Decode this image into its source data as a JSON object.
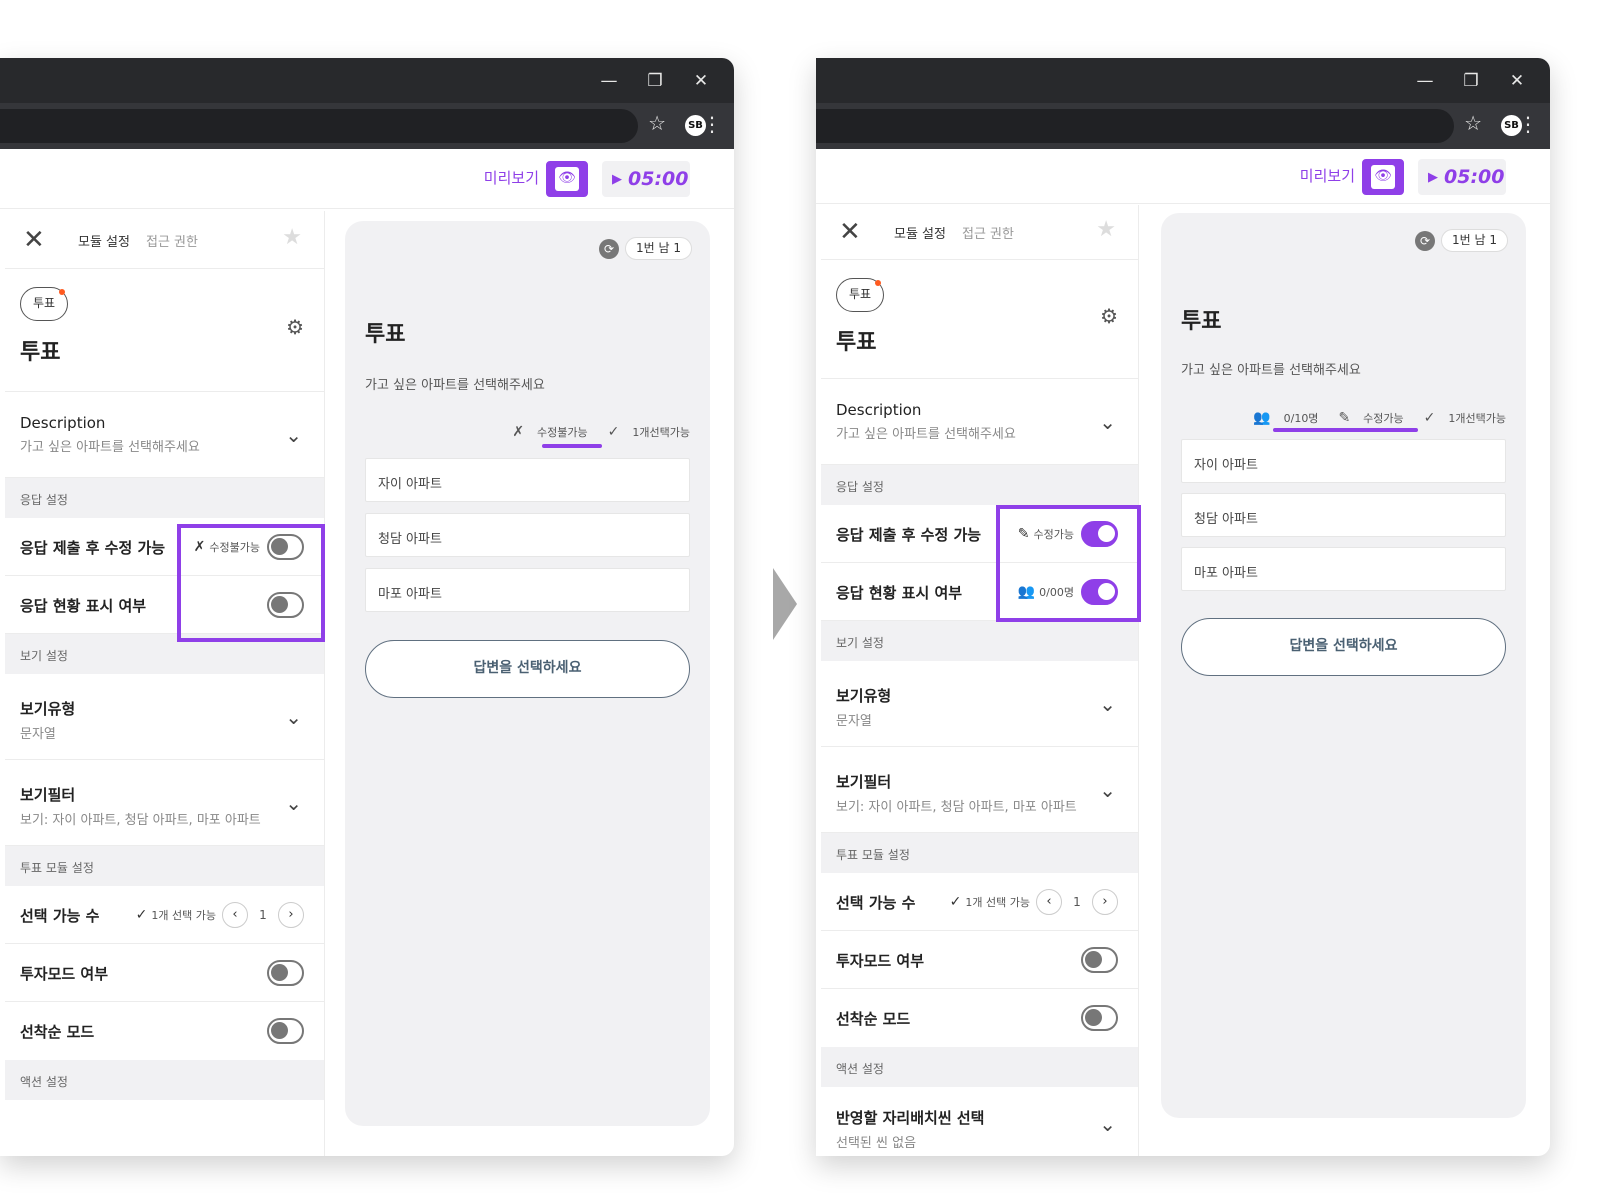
{
  "colors": {
    "accent": "#8f3fe8",
    "chrome": "#28292c",
    "panel_bg": "#f1f1f3",
    "notification_dot": "#ff5a1f"
  },
  "icons": {
    "minimize": "—",
    "restore": "❐",
    "close": "✕",
    "bookmark": "☆",
    "menu": "⋮",
    "eye": "👁",
    "play": "▶",
    "settings": "⚙",
    "chevron": "⌄",
    "prev": "‹",
    "next": "›",
    "check": "✓",
    "edit": "✎",
    "no_edit": "✗",
    "people": "👥",
    "sync": "⟳",
    "star": "★"
  },
  "common": {
    "profile": "SB",
    "preview_label": "미리보기",
    "timer": "05:00",
    "tab_module_settings": "모듈 설정",
    "tab_access": "접근 권한",
    "chip_label": "투표",
    "module_title": "투표",
    "description_label": "Description",
    "description_value": "가고 싶은 아파트를 선택해주세요",
    "section_response": "응답 설정",
    "edit_after_submit": "응답 제출 후 수정 가능",
    "show_status": "응답 현황 표시 여부",
    "section_view": "보기 설정",
    "view_type_label": "보기유형",
    "view_type_value": "문자열",
    "view_filter_label": "보기필터",
    "view_filter_value": "보기: 자이 아파트, 청담 아파트, 마포 아파트",
    "section_vote": "투표 모듈 설정",
    "selectable_count": "선택 가능 수",
    "selectable_badge": "1개 선택 가능",
    "stepper_value": "1",
    "invest_mode": "투자모드 여부",
    "first_come_mode": "선착순 모드",
    "section_action": "액션 설정",
    "page_info": "1번 남 1",
    "preview_title": "투표",
    "preview_desc": "가고 싶은 아파트를 선택해주세요",
    "options": [
      "자이 아파트",
      "청담 아파트",
      "마포 아파트"
    ],
    "answer_button": "답변을 선택하세요",
    "select_one_badge": "1개선택가능"
  },
  "screen1": {
    "edit_badge": "수정불가능",
    "edit_toggle_on": false,
    "status_toggle_on": false
  },
  "screen2": {
    "edit_badge": "수정가능",
    "status_badge": "0/00명",
    "edit_toggle_on": true,
    "status_toggle_on": true,
    "preview_count_badge": "0/10명",
    "preview_edit_badge": "수정가능",
    "seat_label": "반영할 자리배치씬 선택",
    "seat_value": "선택된 씬 없음"
  }
}
